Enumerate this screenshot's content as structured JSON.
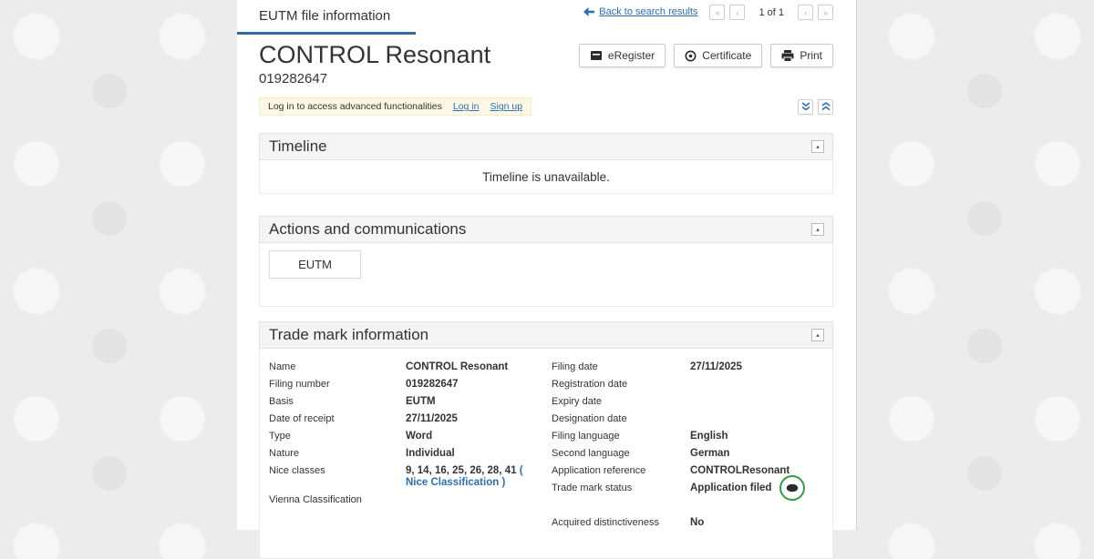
{
  "colors": {
    "accent_blue": "#2a6ebb",
    "status_green": "#2f9e3e",
    "tab_underline": "#2d6ca2"
  },
  "top": {
    "tab_title": "EUTM file information",
    "back_link": "Back to search results",
    "page_indicator": "1 of 1",
    "pager": {
      "first": "«",
      "prev": "‹",
      "next": "›",
      "last": "»"
    }
  },
  "header": {
    "title": "CONTROL Resonant",
    "filing_number": "019282647",
    "buttons": {
      "eregister": "eRegister",
      "certificate": "Certificate",
      "print": "Print"
    }
  },
  "login_bar": {
    "message": "Log in to access advanced functionalities",
    "login_link": "Log in",
    "signup_link": "Sign up"
  },
  "timeline": {
    "title": "Timeline",
    "empty_message": "Timeline is unavailable."
  },
  "actions": {
    "title": "Actions and communications",
    "tab_label": "EUTM"
  },
  "trademark": {
    "title": "Trade mark information",
    "left_rows": [
      {
        "label": "Name",
        "value": "CONTROL Resonant"
      },
      {
        "label": "Filing number",
        "value": "019282647"
      },
      {
        "label": "Basis",
        "value": "EUTM"
      },
      {
        "label": "Date of receipt",
        "value": "27/11/2025"
      },
      {
        "label": "Type",
        "value": "Word"
      },
      {
        "label": "Nature",
        "value": "Individual"
      },
      {
        "label": "Nice classes",
        "value": "9, 14, 16, 25, 26, 28, 41",
        "link": "( Nice Classification )"
      },
      {
        "label": "Vienna Classification",
        "value": ""
      }
    ],
    "right_rows": [
      {
        "label": "Filing date",
        "value": "27/11/2025"
      },
      {
        "label": "Registration date",
        "value": ""
      },
      {
        "label": "Expiry date",
        "value": ""
      },
      {
        "label": "Designation date",
        "value": ""
      },
      {
        "label": "Filing language",
        "value": "English"
      },
      {
        "label": "Second language",
        "value": "German"
      },
      {
        "label": "Application reference",
        "value": "CONTROLResonant"
      },
      {
        "label": "Trade mark status",
        "value": "Application filed",
        "status_icon": true
      },
      {
        "spacer": true
      },
      {
        "label": "Acquired distinctiveness",
        "value": "No"
      }
    ]
  }
}
